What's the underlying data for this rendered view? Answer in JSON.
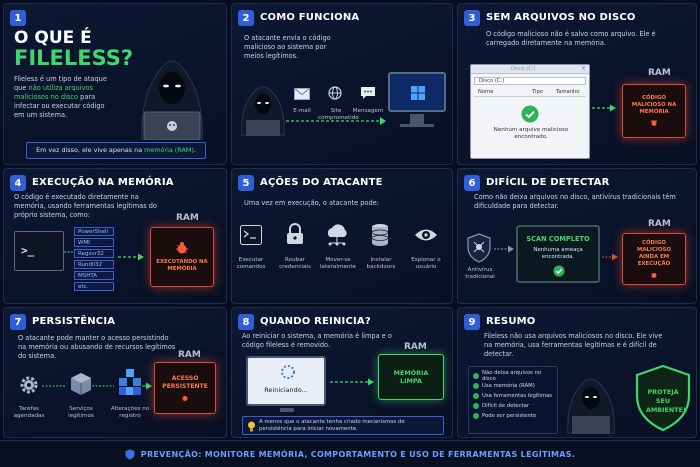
{
  "panels": {
    "p1": {
      "number": "1",
      "title_line1": "O QUE É",
      "title_line2": "FILELESS?",
      "desc_pre": "Fileless é um tipo de ataque que ",
      "desc_highlight": "não utiliza arquivos maliciosos no disco",
      "desc_post": " para infectar ou executar código em um sistema.",
      "note_pre": "Em vez disso, ele vive apenas na ",
      "note_highlight": "memória (RAM)",
      "note_post": "."
    },
    "p2": {
      "number": "2",
      "title": "COMO FUNCIONA",
      "desc": "O atacante envia o código malicioso ao sistema por meios legítimos.",
      "labels": [
        "E-mail",
        "Site comprometido",
        "Mensagem"
      ]
    },
    "p3": {
      "number": "3",
      "title": "SEM ARQUIVOS NO DISCO",
      "desc": "O código malicioso não é salvo como arquivo. Ele é carregado diretamente na memória.",
      "window_title": "Disco (C:)",
      "address": "Disco (C:)",
      "columns": [
        "Nome",
        "Tipo",
        "Tamanho"
      ],
      "empty_message": "Nenhum arquivo malicioso encontrado.",
      "ram_label": "RAM",
      "chip_text": "CÓDIGO MALICIOSO NA MEMÓRIA"
    },
    "p4": {
      "number": "4",
      "title": "EXECUÇÃO NA MEMÓRIA",
      "desc": "O código é executado diretamente na memória, usando ferramentas legítimas do próprio sistema, como:",
      "tools": [
        "PowerShell",
        "WMI",
        "Regsvr32",
        "Rundll32",
        "MSHTA",
        "etc."
      ],
      "terminal_prompt": ">_",
      "ram_label": "RAM",
      "chip_text": "EXECUTANDO NA MEMÓRIA"
    },
    "p5": {
      "number": "5",
      "title": "AÇÕES DO ATACANTE",
      "desc": "Uma vez em execução, o atacante pode:",
      "actions": [
        "Executar comandos",
        "Roubar credenciais",
        "Mover-se lateralmente",
        "Instalar backdoors",
        "Espionar o usuário"
      ]
    },
    "p6": {
      "number": "6",
      "title": "DIFÍCIL DE DETECTAR",
      "desc": "Como não deixa arquivos no disco, antivírus tradicionais têm dificuldade para detectar.",
      "av_label": "Antivírus tradicional",
      "scan_title": "SCAN COMPLETO",
      "scan_result": "Nenhuma ameaça encontrada.",
      "ram_label": "RAM",
      "chip_text": "CÓDIGO MALICIOSO AINDA EM EXECUÇÃO"
    },
    "p7": {
      "number": "7",
      "title": "PERSISTÊNCIA",
      "desc": "O atacante pode manter o acesso persistindo na memória ou abusando de recursos legítimos do sistema.",
      "items": [
        "Tarefas agendadas",
        "Serviços legítimos",
        "Alterações no registro"
      ],
      "ram_label": "RAM",
      "chip_text": "ACESSO PERSISTENTE"
    },
    "p8": {
      "number": "8",
      "title": "QUANDO REINICIA?",
      "desc": "Ao reiniciar o sistema, a memória é limpa e o código fileless é removido.",
      "restart_text": "Reiniciando...",
      "ram_label": "RAM",
      "clean_text": "MEMÓRIA LIMPA",
      "note": "A menos que o atacante tenha criado mecanismos de persistência para iniciar novamente."
    },
    "p9": {
      "number": "9",
      "title": "RESUMO",
      "desc": "Fileless não usa arquivos maliciosos no disco. Ele vive na memória, usa ferramentas legítimas e é difícil de detectar.",
      "checklist": [
        "Não deixa arquivos no disco",
        "Usa memória (RAM)",
        "Usa ferramentas legítimas",
        "Difícil de detectar",
        "Pode ser persistente"
      ],
      "shield_text": "PROTEJA SEU AMBIENTE!"
    }
  },
  "footer": {
    "text": "PREVENÇÃO: MONITORE MEMÓRIA, COMPORTAMENTO E USO DE FERRAMENTAS LEGÍTIMAS."
  },
  "colors": {
    "accent_blue": "#2f5ed8",
    "green": "#3fd66a",
    "danger": "#e0492f",
    "background": "#070d1e"
  }
}
